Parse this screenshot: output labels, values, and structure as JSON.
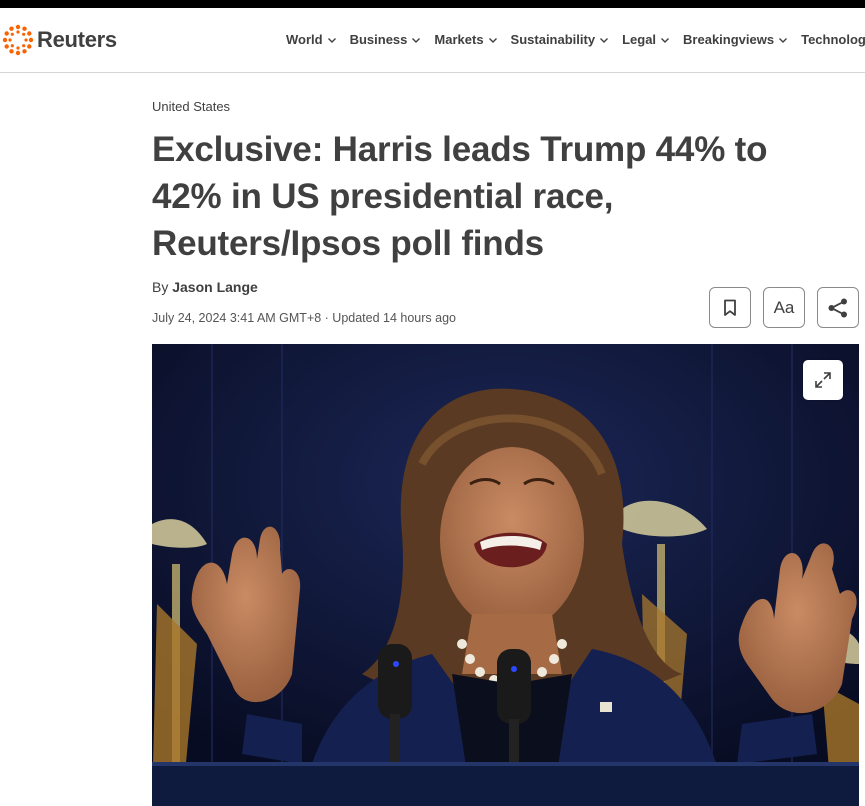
{
  "brand": {
    "name": "Reuters",
    "accent": "#fa6400"
  },
  "nav": {
    "items": [
      {
        "label": "World"
      },
      {
        "label": "Business"
      },
      {
        "label": "Markets"
      },
      {
        "label": "Sustainability"
      },
      {
        "label": "Legal"
      },
      {
        "label": "Breakingviews"
      },
      {
        "label": "Technology"
      }
    ]
  },
  "article": {
    "section": "United States",
    "headline": "Exclusive: Harris leads Trump 44% to 42% in US presidential race, Reuters/Ipsos poll finds",
    "byline_prefix": "By",
    "author": "Jason Lange",
    "dateline": "July 24, 2024 3:41 AM GMT+8 · Updated 14 hours ago"
  },
  "tools": {
    "bookmark_icon": "bookmark-icon",
    "text_size_label": "Aa",
    "share_icon": "share-icon"
  },
  "hero": {
    "expand_icon": "expand-icon",
    "background": "#0d1433"
  }
}
